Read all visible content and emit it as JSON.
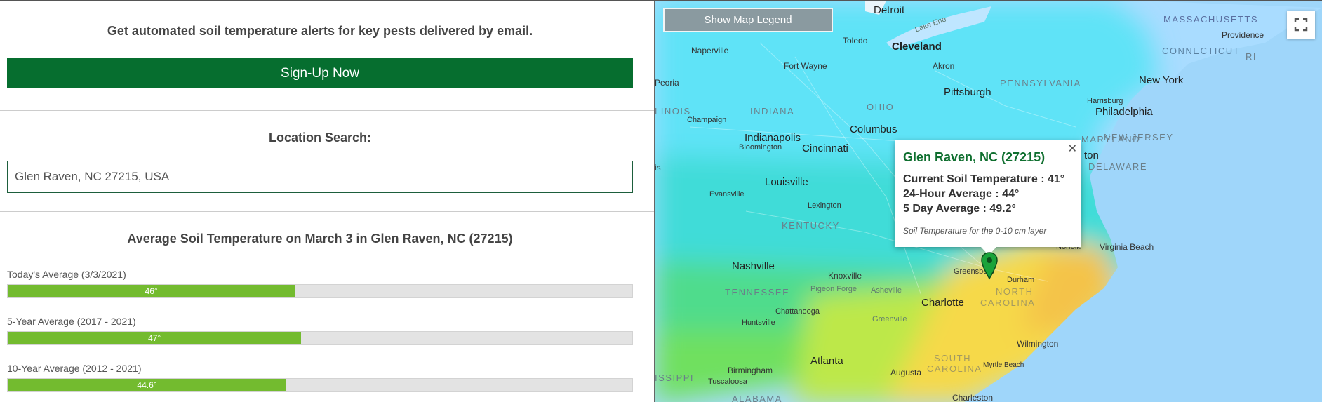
{
  "alert": {
    "text": "Get automated soil temperature alerts for key pests delivered by email.",
    "signup_label": "Sign-Up Now"
  },
  "location": {
    "label": "Location Search:",
    "value": "Glen Raven, NC 27215, USA"
  },
  "averages": {
    "title": "Average Soil Temperature on March 3 in Glen Raven, NC (27215)",
    "bars": [
      {
        "label": "Today's Average (3/3/2021)",
        "value": "46°",
        "fill_fraction": 0.46
      },
      {
        "label": "5-Year Average (2017 - 2021)",
        "value": "47°",
        "fill_fraction": 0.47
      },
      {
        "label": "10-Year Average (2012 - 2021)",
        "value": "44.6°",
        "fill_fraction": 0.446
      }
    ],
    "bar_color": "#73bb2f"
  },
  "map": {
    "legend_button": "Show Map Legend",
    "fullscreen_icon": "fullscreen-icon",
    "popup": {
      "title": "Glen Raven, NC (27215)",
      "current": "Current Soil Temperature : 41°",
      "day_avg": "24-Hour Average : 44°",
      "five_day": "5 Day Average : 49.2°",
      "note": "Soil Temperature for the 0-10 cm layer"
    },
    "places": {
      "detroit": "Detroit",
      "toledo": "Toledo",
      "cleveland": "Cleveland",
      "lake_erie": "Lake Erie",
      "massachusetts": "MASSACHUSETTS",
      "providence": "Providence",
      "connecticut": "CONNECTICUT",
      "ri": "RI",
      "naperville": "Naperville",
      "fort_wayne": "Fort Wayne",
      "akron": "Akron",
      "pennsylvania": "PENNSYLVANIA",
      "new_york": "New York",
      "peoria": "Peoria",
      "pittsburgh": "Pittsburgh",
      "harrisburg": "Harrisburg",
      "illinois": "LINOIS",
      "indiana": "INDIANA",
      "ohio": "OHIO",
      "philadelphia": "Philadelphia",
      "champaign": "Champaign",
      "columbus": "Columbus",
      "indianapolis": "Indianapolis",
      "bloomington": "Bloomington",
      "cincinnati": "Cincinnati",
      "maryland": "MARYLAND",
      "new_jersey": "NEW JERSEY",
      "delaware": "DELAWARE",
      "louisville": "Louisville",
      "evansville": "Evansville",
      "lexington": "Lexington",
      "kentucky": "KENTUCKY",
      "norfolk": "Norfolk",
      "virginia_beach": "Virginia Beach",
      "nashville": "Nashville",
      "knoxville": "Knoxville",
      "greensboro": "Greensboro",
      "durham": "Durham",
      "tennessee": "TENNESSEE",
      "pigeon_forge": "Pigeon Forge",
      "asheville": "Asheville",
      "charlotte": "Charlotte",
      "north_carolina_1": "NORTH",
      "north_carolina_2": "CAROLINA",
      "huntsville": "Huntsville",
      "chattanooga": "Chattanooga",
      "greenville": "Greenville",
      "wilmington": "Wilmington",
      "atlanta": "Atlanta",
      "south_carolina_1": "SOUTH",
      "south_carolina_2": "CAROLINA",
      "myrtle_beach": "Myrtle Beach",
      "birmingham": "Birmingham",
      "augusta": "Augusta",
      "tuscaloosa": "Tuscaloosa",
      "mississippi": "ISSIPPI",
      "alabama": "ALABAMA",
      "charleston": "Charleston",
      "ton": "ton",
      "is": "is"
    }
  }
}
